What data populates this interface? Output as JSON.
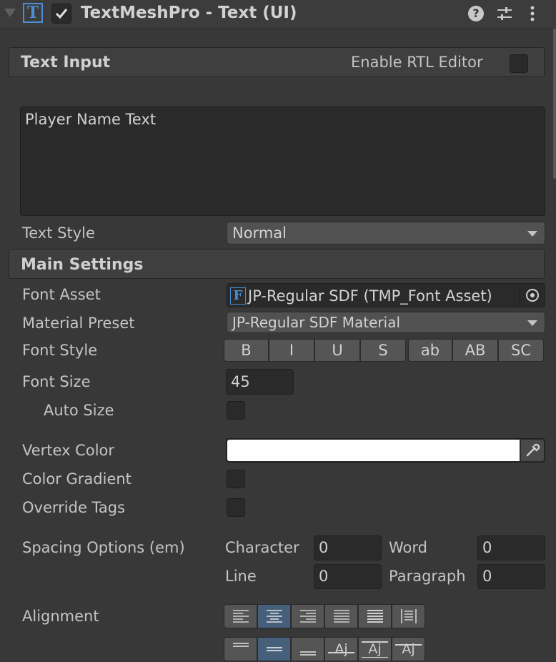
{
  "header": {
    "component_title": "TextMeshPro - Text (UI)",
    "component_icon": "T"
  },
  "text_input": {
    "section_title": "Text Input",
    "rtl_label": "Enable RTL Editor",
    "text_value": "Player Name Text",
    "text_style_label": "Text Style",
    "text_style_value": "Normal"
  },
  "main_settings": {
    "section_title": "Main Settings",
    "font_asset_label": "Font Asset",
    "font_asset_value": "JP-Regular SDF (TMP_Font Asset)",
    "font_asset_icon": "F",
    "material_preset_label": "Material Preset",
    "material_preset_value": "JP-Regular SDF Material",
    "font_style_label": "Font Style",
    "font_style_buttons": [
      "B",
      "I",
      "U",
      "S",
      "ab",
      "AB",
      "SC"
    ],
    "font_size_label": "Font Size",
    "font_size_value": "45",
    "auto_size_label": "Auto Size",
    "vertex_color_label": "Vertex Color",
    "vertex_color": "#ffffff",
    "color_gradient_label": "Color Gradient",
    "override_tags_label": "Override Tags",
    "spacing_label": "Spacing Options (em)",
    "character_label": "Character",
    "character_value": "0",
    "word_label": "Word",
    "word_value": "0",
    "line_label": "Line",
    "line_value": "0",
    "paragraph_label": "Paragraph",
    "paragraph_value": "0",
    "alignment_label": "Alignment",
    "vertical_glyphs": [
      "Aj",
      "Aj",
      "Aj"
    ]
  },
  "colors": {
    "background": "#383838",
    "selected_button": "#46607c",
    "icon_blue": "#4a8fd6"
  }
}
